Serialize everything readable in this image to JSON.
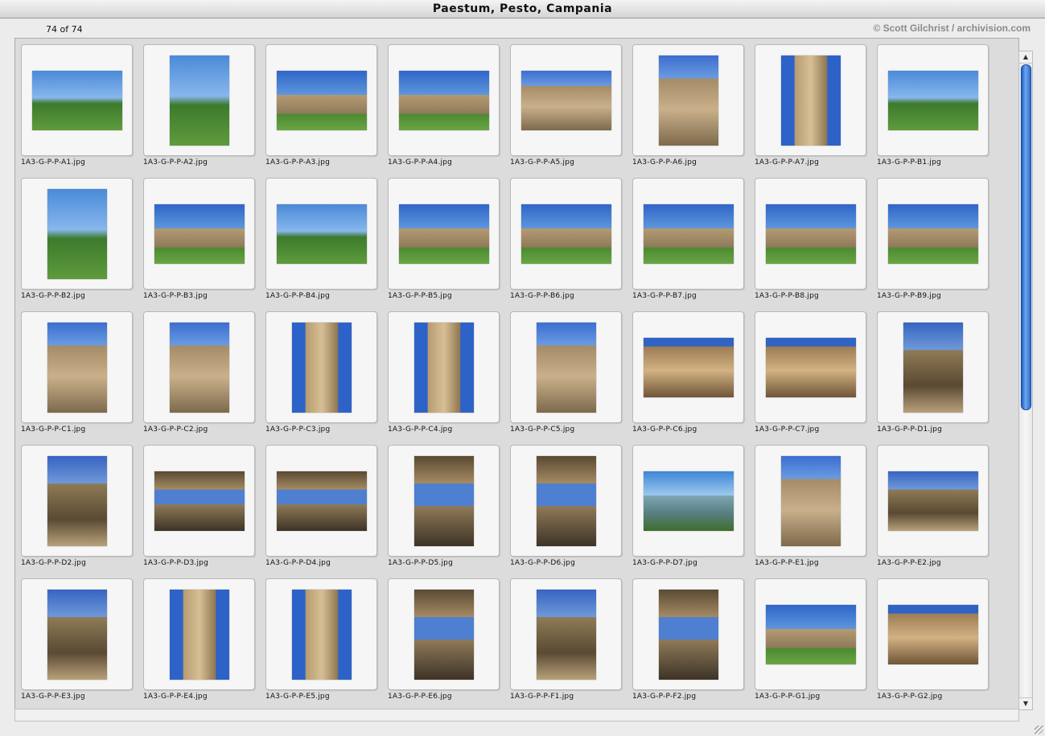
{
  "window": {
    "title": "Paestum, Pesto, Campania"
  },
  "info": {
    "count": "74 of 74",
    "credit": "© Scott Gilchrist / archivision.com"
  },
  "items": [
    {
      "name": "1A3-G-P-P-A1.jpg",
      "orientation": "landscape",
      "scene": "s-blue-green"
    },
    {
      "name": "1A3-G-P-P-A2.jpg",
      "orientation": "portrait",
      "scene": "s-blue-green"
    },
    {
      "name": "1A3-G-P-P-A3.jpg",
      "orientation": "landscape",
      "scene": "s-temple"
    },
    {
      "name": "1A3-G-P-P-A4.jpg",
      "orientation": "landscape",
      "scene": "s-temple"
    },
    {
      "name": "1A3-G-P-P-A5.jpg",
      "orientation": "landscape",
      "scene": "s-stone"
    },
    {
      "name": "1A3-G-P-P-A6.jpg",
      "orientation": "portrait",
      "scene": "s-stone"
    },
    {
      "name": "1A3-G-P-P-A7.jpg",
      "orientation": "portrait",
      "scene": "s-column"
    },
    {
      "name": "1A3-G-P-P-B1.jpg",
      "orientation": "landscape",
      "scene": "s-blue-green"
    },
    {
      "name": "1A3-G-P-P-B2.jpg",
      "orientation": "portrait",
      "scene": "s-blue-green"
    },
    {
      "name": "1A3-G-P-P-B3.jpg",
      "orientation": "landscape",
      "scene": "s-temple"
    },
    {
      "name": "1A3-G-P-P-B4.jpg",
      "orientation": "landscape",
      "scene": "s-blue-green"
    },
    {
      "name": "1A3-G-P-P-B5.jpg",
      "orientation": "landscape",
      "scene": "s-temple"
    },
    {
      "name": "1A3-G-P-P-B6.jpg",
      "orientation": "landscape",
      "scene": "s-temple"
    },
    {
      "name": "1A3-G-P-P-B7.jpg",
      "orientation": "landscape",
      "scene": "s-temple"
    },
    {
      "name": "1A3-G-P-P-B8.jpg",
      "orientation": "landscape",
      "scene": "s-temple"
    },
    {
      "name": "1A3-G-P-P-B9.jpg",
      "orientation": "landscape",
      "scene": "s-temple"
    },
    {
      "name": "1A3-G-P-P-C1.jpg",
      "orientation": "portrait",
      "scene": "s-stone"
    },
    {
      "name": "1A3-G-P-P-C2.jpg",
      "orientation": "portrait",
      "scene": "s-stone"
    },
    {
      "name": "1A3-G-P-P-C3.jpg",
      "orientation": "portrait",
      "scene": "s-column"
    },
    {
      "name": "1A3-G-P-P-C4.jpg",
      "orientation": "portrait",
      "scene": "s-column"
    },
    {
      "name": "1A3-G-P-P-C5.jpg",
      "orientation": "portrait",
      "scene": "s-stone"
    },
    {
      "name": "1A3-G-P-P-C6.jpg",
      "orientation": "landscape",
      "scene": "s-frieze"
    },
    {
      "name": "1A3-G-P-P-C7.jpg",
      "orientation": "landscape",
      "scene": "s-frieze"
    },
    {
      "name": "1A3-G-P-P-D1.jpg",
      "orientation": "portrait",
      "scene": "s-shadow"
    },
    {
      "name": "1A3-G-P-P-D2.jpg",
      "orientation": "portrait",
      "scene": "s-shadow"
    },
    {
      "name": "1A3-G-P-P-D3.jpg",
      "orientation": "landscape",
      "scene": "s-interior"
    },
    {
      "name": "1A3-G-P-P-D4.jpg",
      "orientation": "landscape",
      "scene": "s-interior"
    },
    {
      "name": "1A3-G-P-P-D5.jpg",
      "orientation": "portrait",
      "scene": "s-interior"
    },
    {
      "name": "1A3-G-P-P-D6.jpg",
      "orientation": "portrait",
      "scene": "s-interior"
    },
    {
      "name": "1A3-G-P-P-D7.jpg",
      "orientation": "landscape",
      "scene": "s-mountain"
    },
    {
      "name": "1A3-G-P-P-E1.jpg",
      "orientation": "portrait",
      "scene": "s-stone"
    },
    {
      "name": "1A3-G-P-P-E2.jpg",
      "orientation": "landscape",
      "scene": "s-shadow"
    },
    {
      "name": "1A3-G-P-P-E3.jpg",
      "orientation": "portrait",
      "scene": "s-shadow"
    },
    {
      "name": "1A3-G-P-P-E4.jpg",
      "orientation": "portrait",
      "scene": "s-column"
    },
    {
      "name": "1A3-G-P-P-E5.jpg",
      "orientation": "portrait",
      "scene": "s-column"
    },
    {
      "name": "1A3-G-P-P-E6.jpg",
      "orientation": "portrait",
      "scene": "s-interior"
    },
    {
      "name": "1A3-G-P-P-F1.jpg",
      "orientation": "portrait",
      "scene": "s-shadow"
    },
    {
      "name": "1A3-G-P-P-F2.jpg",
      "orientation": "portrait",
      "scene": "s-interior"
    },
    {
      "name": "1A3-G-P-P-G1.jpg",
      "orientation": "landscape",
      "scene": "s-temple"
    },
    {
      "name": "1A3-G-P-P-G2.jpg",
      "orientation": "landscape",
      "scene": "s-frieze"
    }
  ],
  "scroll": {
    "position": 0.0
  },
  "icons": {
    "up": "scroll-up-arrow-icon",
    "down": "scroll-down-arrow-icon",
    "resize": "resize-grip-icon"
  }
}
